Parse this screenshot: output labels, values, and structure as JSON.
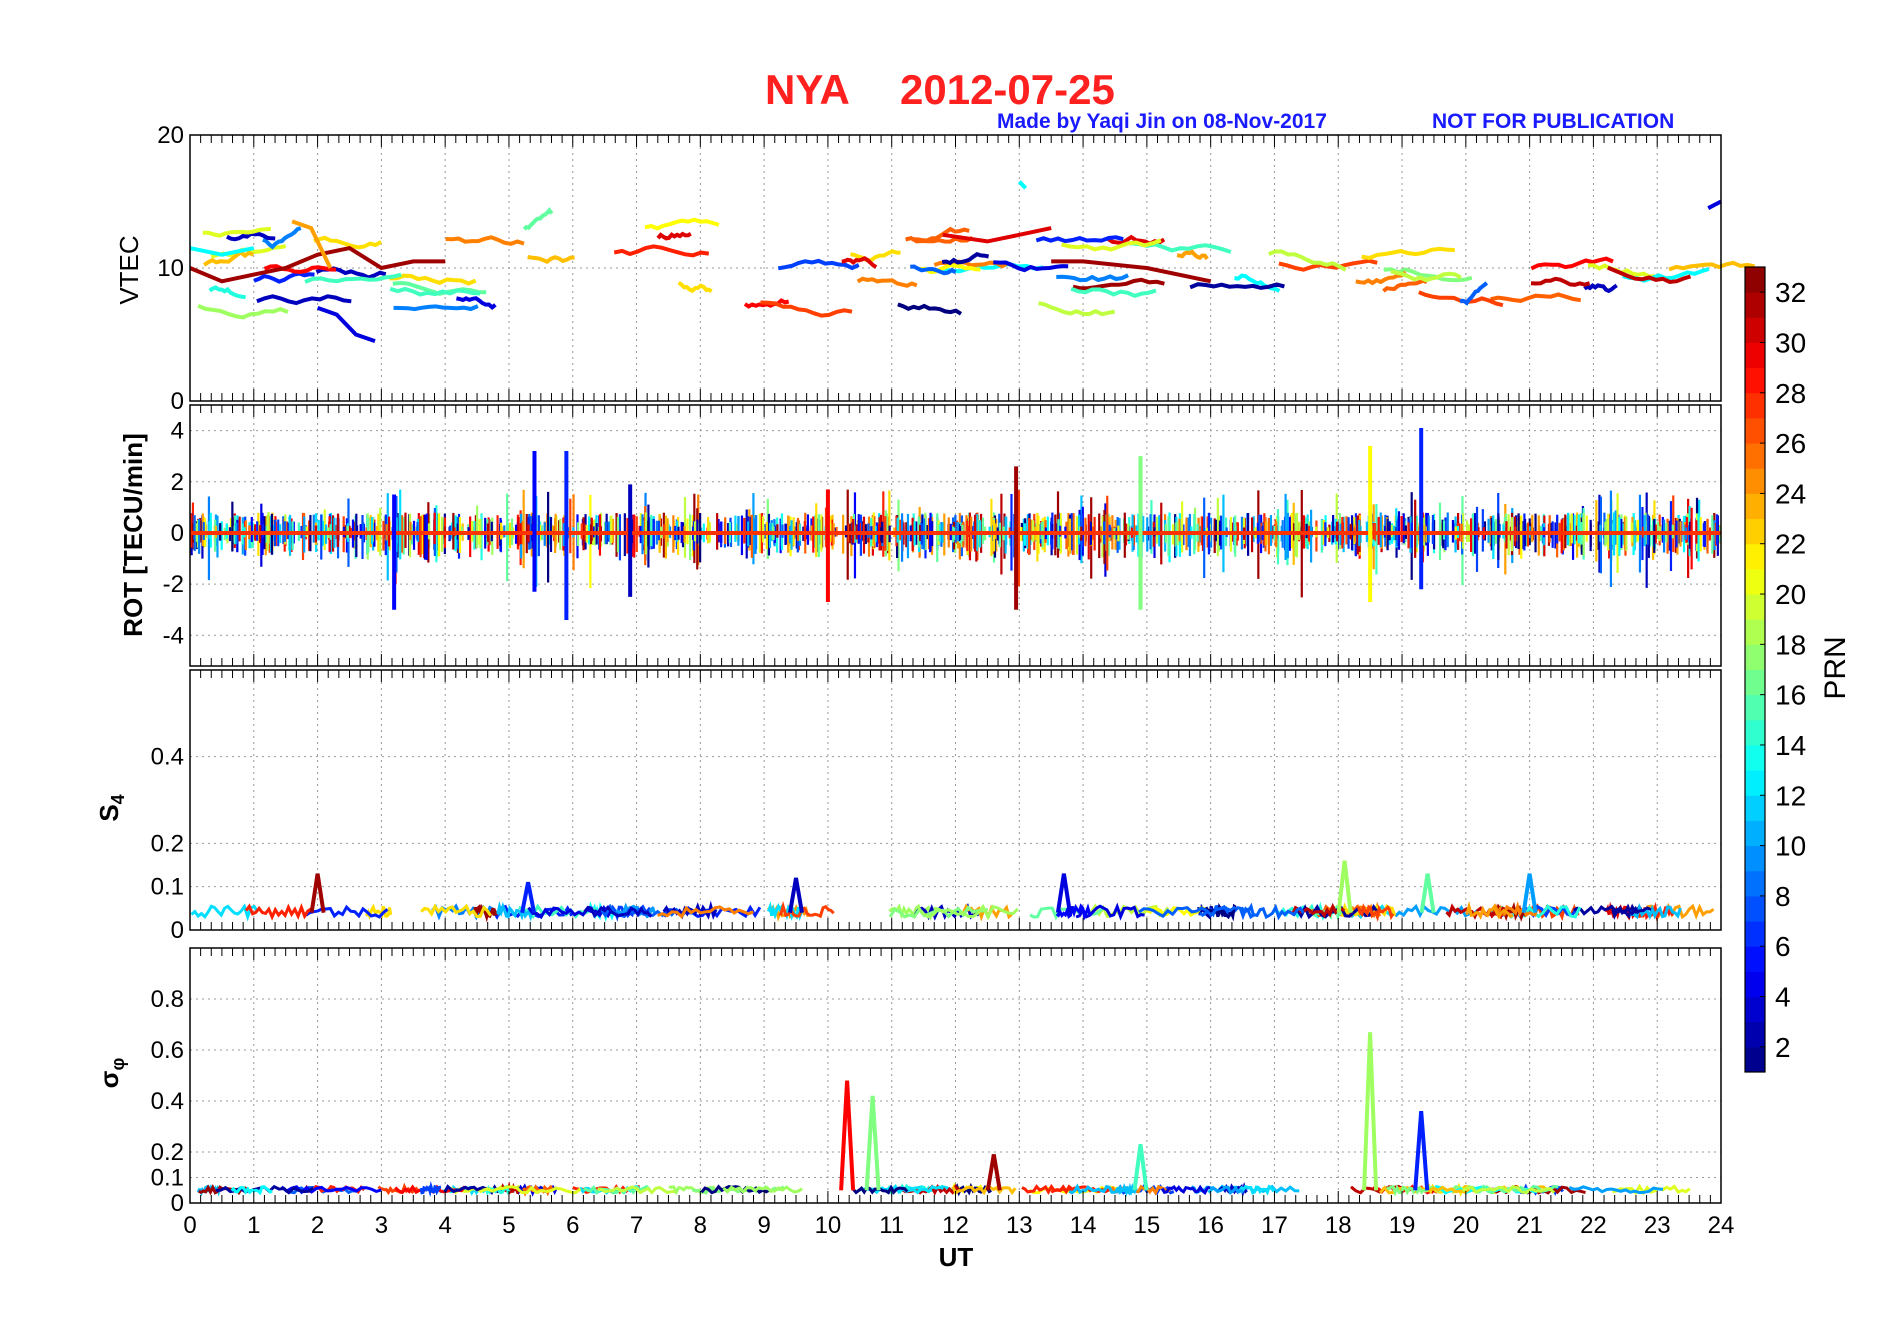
{
  "title": {
    "station": "NYA",
    "date": "2012-07-25"
  },
  "credit": {
    "author": "Made by Yaqi Jin on 08-Nov-2017",
    "notice": "NOT FOR PUBLICATION"
  },
  "colorbar": {
    "label": "PRN",
    "ticks": [
      "2",
      "4",
      "6",
      "8",
      "10",
      "12",
      "14",
      "16",
      "18",
      "20",
      "22",
      "24",
      "26",
      "28",
      "30",
      "32"
    ],
    "range": [
      1,
      33
    ],
    "colormap": "jet"
  },
  "chart_data": [
    {
      "type": "line",
      "panel": "VTEC",
      "ylabel": "VTEC",
      "ylim": [
        0,
        20
      ],
      "yticks": [
        "0",
        "10",
        "20"
      ],
      "xlim": [
        0,
        24
      ],
      "grid": true,
      "series": [
        {
          "prn": 32,
          "x": [
            0,
            0.5,
            1,
            1.5,
            2,
            2.5,
            3,
            3.5,
            4
          ],
          "values": [
            10,
            9,
            9.5,
            10,
            11,
            11.5,
            10,
            10.5,
            10.5
          ]
        },
        {
          "prn": 4,
          "x": [
            2,
            2.3,
            2.6,
            2.9
          ],
          "values": [
            7,
            6.5,
            5,
            4.5
          ]
        },
        {
          "prn": 13,
          "x": [
            0,
            0.5,
            1
          ],
          "values": [
            11.5,
            11,
            11.5
          ]
        },
        {
          "prn": 24,
          "x": [
            1.6,
            1.9,
            2.2
          ],
          "values": [
            13.5,
            13,
            10
          ]
        },
        {
          "prn": 13,
          "x": [
            13,
            13.1
          ],
          "values": [
            16.5,
            16
          ]
        },
        {
          "prn": 4,
          "x": [
            23.8,
            24
          ],
          "values": [
            14.5,
            15
          ]
        },
        {
          "prn": 30,
          "x": [
            11.8,
            12.5,
            13,
            13.5
          ],
          "values": [
            12.5,
            12,
            12.5,
            13
          ]
        },
        {
          "prn": 32,
          "x": [
            13.5,
            14,
            15,
            16
          ],
          "values": [
            10.5,
            10.5,
            10,
            9
          ]
        }
      ]
    },
    {
      "type": "line",
      "panel": "ROT",
      "ylabel": "ROT [TECU/min]",
      "ylim": [
        -5.2,
        5
      ],
      "yticks": [
        "-4",
        "-2",
        "0",
        "2",
        "4"
      ],
      "xlim": [
        0,
        24
      ],
      "grid": true,
      "spikes": [
        {
          "x": 3.2,
          "min": -3.0,
          "max": 1.5,
          "prn": 5
        },
        {
          "x": 5.4,
          "min": -2.3,
          "max": 3.2,
          "prn": 5
        },
        {
          "x": 5.9,
          "min": -3.4,
          "max": 3.2,
          "prn": 6
        },
        {
          "x": 6.9,
          "min": -2.5,
          "max": 1.9,
          "prn": 3
        },
        {
          "x": 10.0,
          "min": -2.7,
          "max": 1.7,
          "prn": 29
        },
        {
          "x": 12.95,
          "min": -3.0,
          "max": 2.6,
          "prn": 32
        },
        {
          "x": 14.9,
          "min": -3.0,
          "max": 3.0,
          "prn": 17
        },
        {
          "x": 18.5,
          "min": -2.7,
          "max": 3.4,
          "prn": 21
        },
        {
          "x": 19.3,
          "min": -2.2,
          "max": 4.1,
          "prn": 6
        }
      ]
    },
    {
      "type": "line",
      "panel": "S4",
      "ylabel": "S4",
      "ylim": [
        0,
        0.6
      ],
      "yticks": [
        "0",
        "0.1",
        "0.2",
        "0.4"
      ],
      "xlim": [
        0,
        24
      ],
      "grid": true,
      "peaks": [
        {
          "x": 2.0,
          "value": 0.13,
          "prn": 32
        },
        {
          "x": 5.3,
          "value": 0.11,
          "prn": 6
        },
        {
          "x": 9.5,
          "value": 0.12,
          "prn": 3
        },
        {
          "x": 13.7,
          "value": 0.13,
          "prn": 4
        },
        {
          "x": 18.1,
          "value": 0.16,
          "prn": 18
        },
        {
          "x": 19.4,
          "value": 0.13,
          "prn": 16
        },
        {
          "x": 21.0,
          "value": 0.13,
          "prn": 10
        }
      ]
    },
    {
      "type": "line",
      "panel": "sigma_phi",
      "ylabel": "σφ",
      "ylim": [
        0,
        1
      ],
      "yticks": [
        "0",
        "0.1",
        "0.2",
        "0.4",
        "0.6",
        "0.8"
      ],
      "xlim": [
        0,
        24
      ],
      "xticks": [
        "0",
        "1",
        "2",
        "3",
        "4",
        "5",
        "6",
        "7",
        "8",
        "9",
        "10",
        "11",
        "12",
        "13",
        "14",
        "15",
        "16",
        "17",
        "18",
        "19",
        "20",
        "21",
        "22",
        "23",
        "24"
      ],
      "xlabel": "UT",
      "grid": true,
      "peaks": [
        {
          "x": 10.3,
          "value": 0.48,
          "prn": 29
        },
        {
          "x": 10.7,
          "value": 0.42,
          "prn": 17
        },
        {
          "x": 18.5,
          "value": 0.67,
          "prn": 18
        },
        {
          "x": 19.3,
          "value": 0.36,
          "prn": 6
        },
        {
          "x": 14.9,
          "value": 0.23,
          "prn": 15
        },
        {
          "x": 12.6,
          "value": 0.19,
          "prn": 32
        }
      ]
    }
  ]
}
